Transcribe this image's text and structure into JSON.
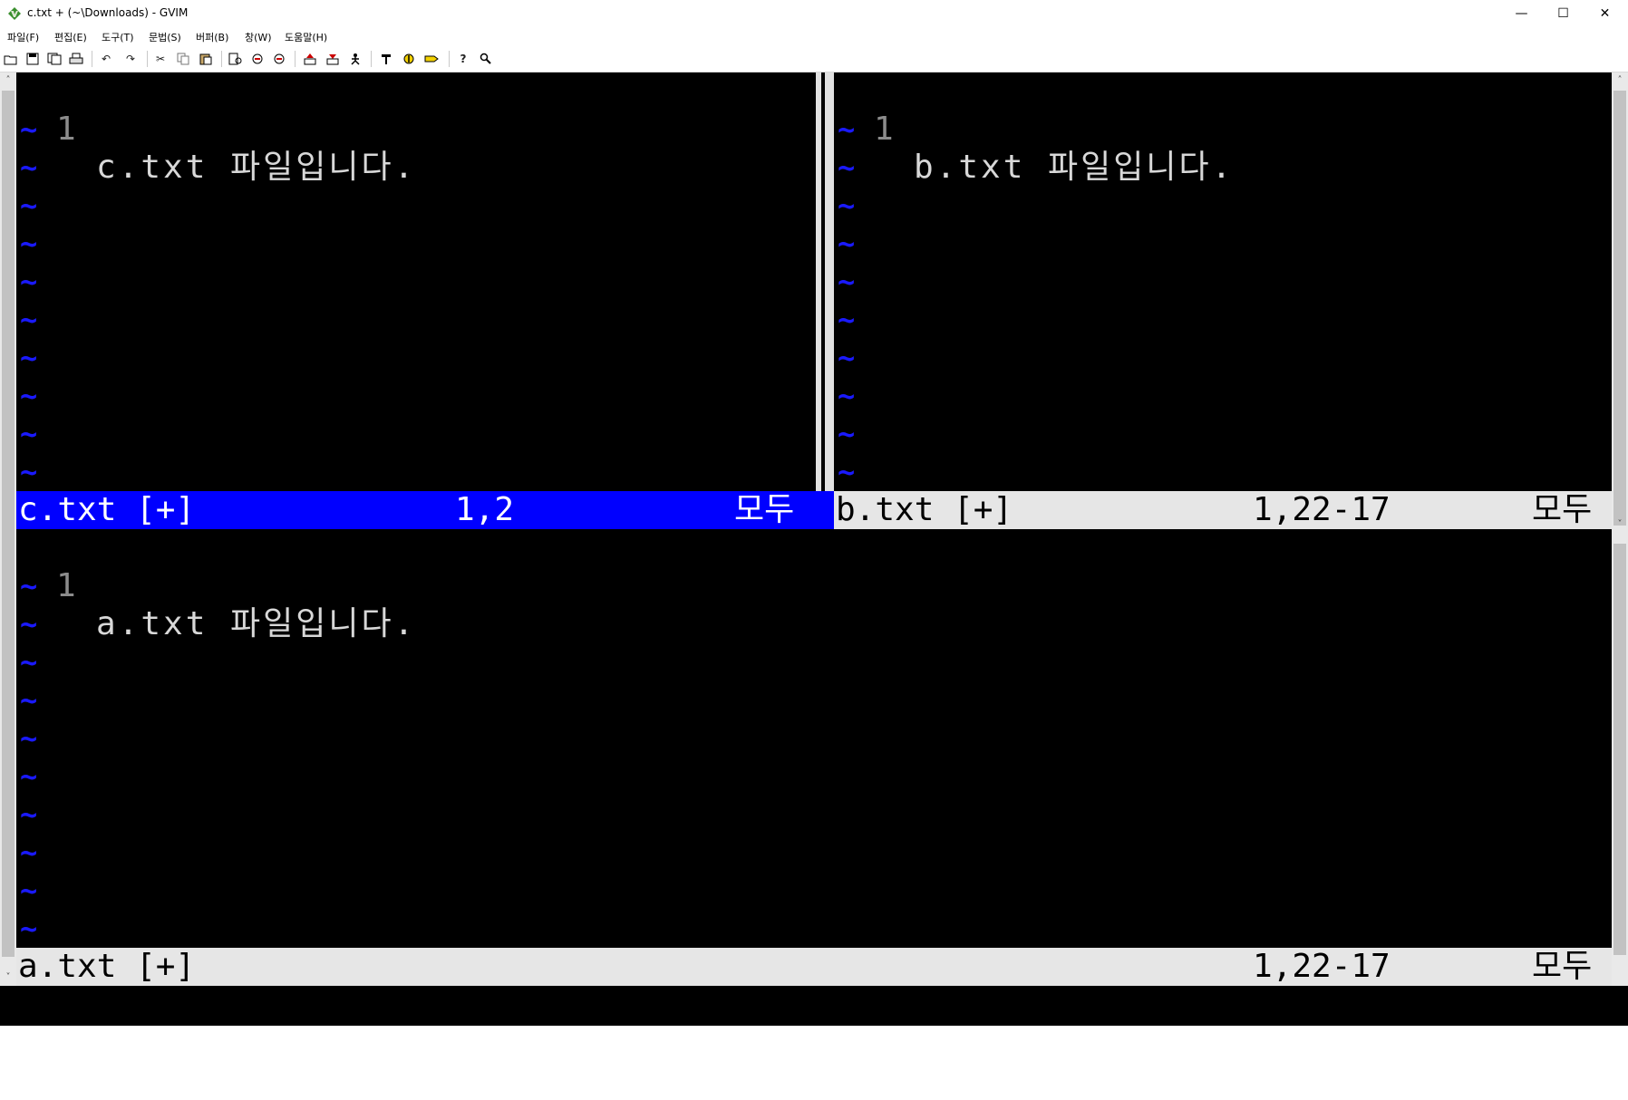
{
  "window": {
    "title": "c.txt + (~\\Downloads) - GVIM",
    "minimize": "—",
    "maximize": "☐",
    "close": "✕"
  },
  "menu": [
    "파일(F)",
    "편집(E)",
    "도구(T)",
    "문법(S)",
    "버퍼(B)",
    "창(W)",
    "도움말(H)"
  ],
  "toolbar_icons": [
    "open-icon",
    "save-icon",
    "save-all-icon",
    "print-icon",
    "undo-icon",
    "redo-icon",
    "cut-icon",
    "copy-icon",
    "paste-icon",
    "find-icon",
    "find-next-icon",
    "find-prev-icon",
    "load-session-icon",
    "save-session-icon",
    "run-script-icon",
    "make-icon",
    "run-ctags-icon",
    "jump-tag-icon",
    "help-icon",
    "find-help-icon"
  ],
  "panes": {
    "top_left": {
      "line_number": "1",
      "text": "c.txt 파일입니다.",
      "status_file": "c.txt [+]",
      "status_pos": "1,2",
      "status_scope": "모두"
    },
    "top_right": {
      "line_number": "1",
      "text": "b.txt 파일입니다.",
      "status_file": "b.txt [+]",
      "status_pos": "1,22-17",
      "status_scope": "모두"
    },
    "bottom": {
      "line_number": "1",
      "text": "a.txt 파일입니다.",
      "status_file": "a.txt [+]",
      "status_pos": "1,22-17",
      "status_scope": "모두"
    }
  },
  "tilde": "~",
  "colors": {
    "active_status": "#0000ff",
    "tilde": "#1a1aff",
    "line_number": "#8c8c8c"
  }
}
